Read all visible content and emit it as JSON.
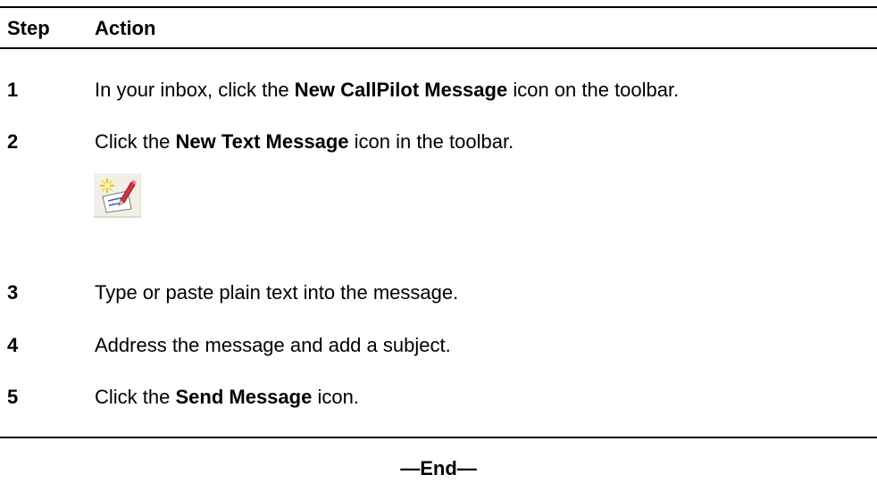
{
  "table": {
    "header": {
      "step": "Step",
      "action": "Action"
    },
    "rows": [
      {
        "step": "1",
        "before": "In your inbox, click the ",
        "bold": "New CallPilot Message",
        "after": " icon on the toolbar."
      },
      {
        "step": "2",
        "before": "Click the ",
        "bold": "New Text Message",
        "after": " icon in the toolbar.",
        "icon": "new-text-message-icon"
      },
      {
        "step": "3",
        "text": "Type or paste plain text into the message."
      },
      {
        "step": "4",
        "text": "Address the message and add a subject."
      },
      {
        "step": "5",
        "before": "Click the ",
        "bold": "Send Message",
        "after": " icon."
      }
    ]
  },
  "footer": {
    "end_label": "—End—"
  }
}
